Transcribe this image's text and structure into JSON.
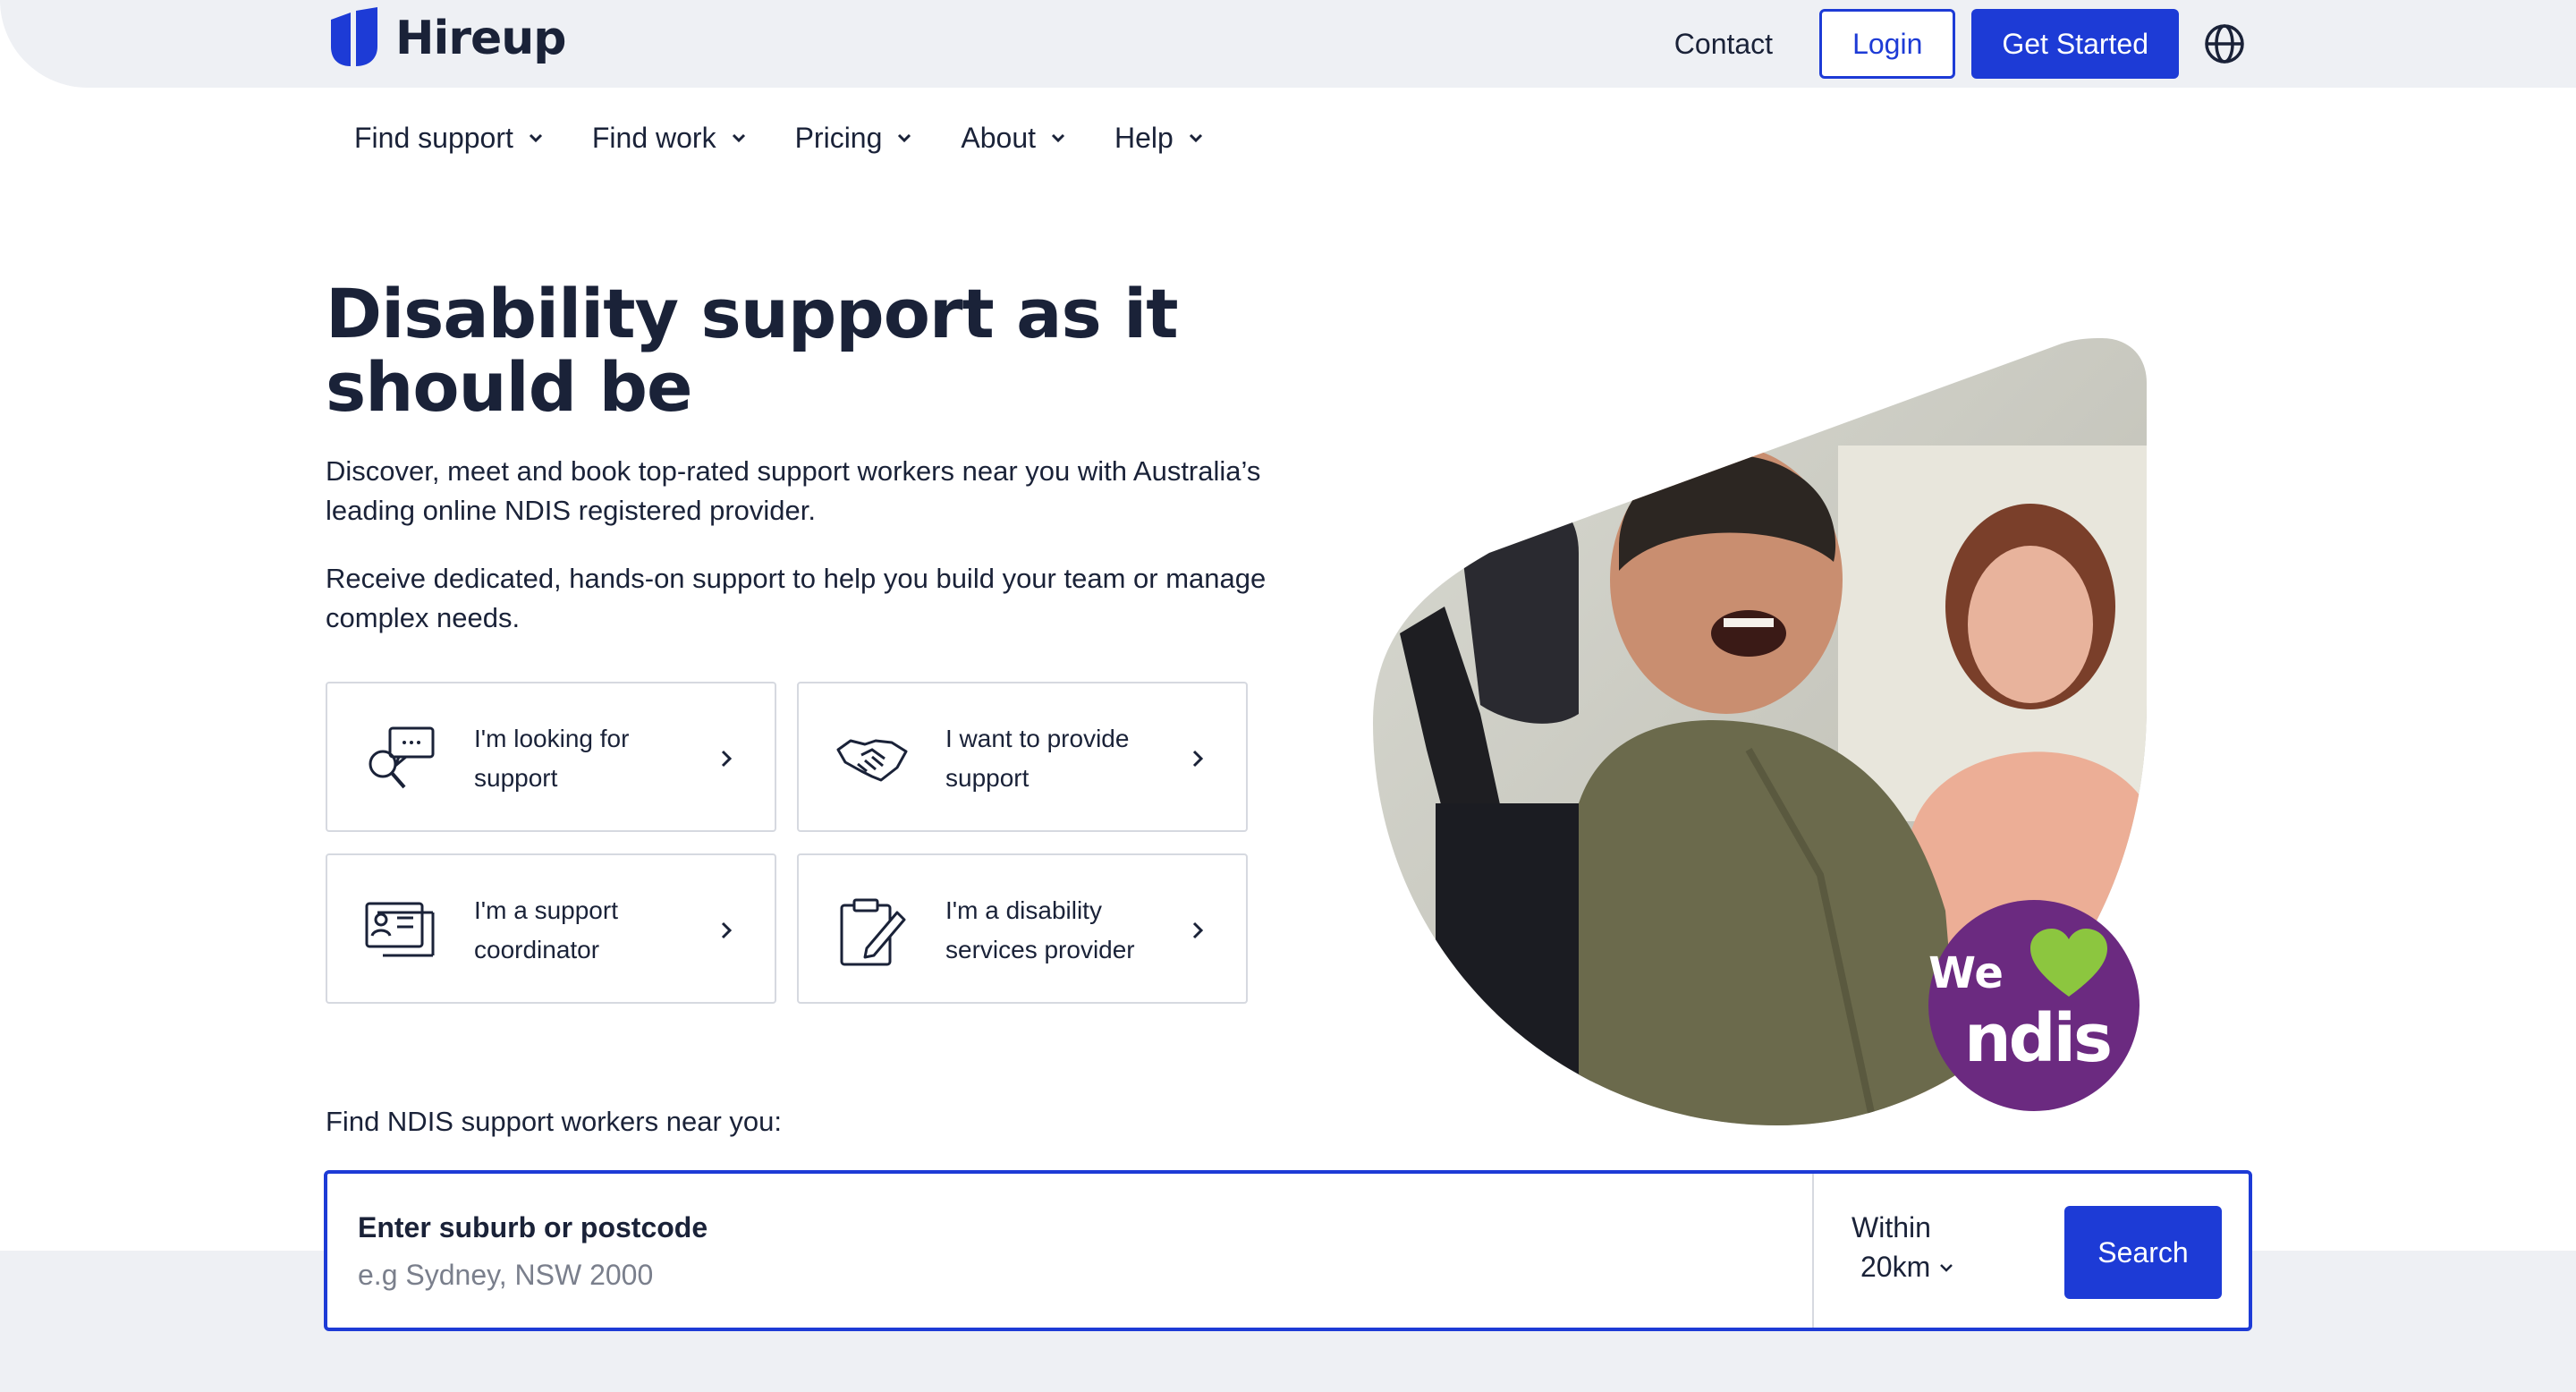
{
  "brand": {
    "name": "Hireup"
  },
  "header": {
    "contact_label": "Contact",
    "login_label": "Login",
    "get_started_label": "Get Started"
  },
  "nav": {
    "items": [
      {
        "label": "Find support"
      },
      {
        "label": "Find work"
      },
      {
        "label": "Pricing"
      },
      {
        "label": "About"
      },
      {
        "label": "Help"
      }
    ]
  },
  "hero": {
    "title": "Disability support as it should be",
    "paragraph1": "Discover, meet and book top-rated support workers near you with Australia’s leading online NDIS registered provider.",
    "paragraph2": "Receive dedicated, hands-on support to help you build your team or manage complex needs."
  },
  "cards": [
    {
      "label": "I'm looking for support",
      "icon": "search-chat-icon"
    },
    {
      "label": "I want to provide support",
      "icon": "handshake-icon"
    },
    {
      "label": "I'm a support coordinator",
      "icon": "id-card-icon"
    },
    {
      "label": "I'm a disability services provider",
      "icon": "clipboard-pen-icon"
    }
  ],
  "badge": {
    "line1": "We",
    "line2": "ndis"
  },
  "search": {
    "heading": "Find NDIS support workers near you:",
    "field_label": "Enter suburb or postcode",
    "placeholder": "e.g Sydney, NSW 2000",
    "value": "",
    "within_label": "Within",
    "within_value": "20km",
    "button_label": "Search"
  },
  "colors": {
    "accent": "#1d3bd6",
    "text": "#1a2238",
    "band": "#eef0f4",
    "ndis_purple": "#6b2a80",
    "ndis_green": "#8cc63f"
  }
}
